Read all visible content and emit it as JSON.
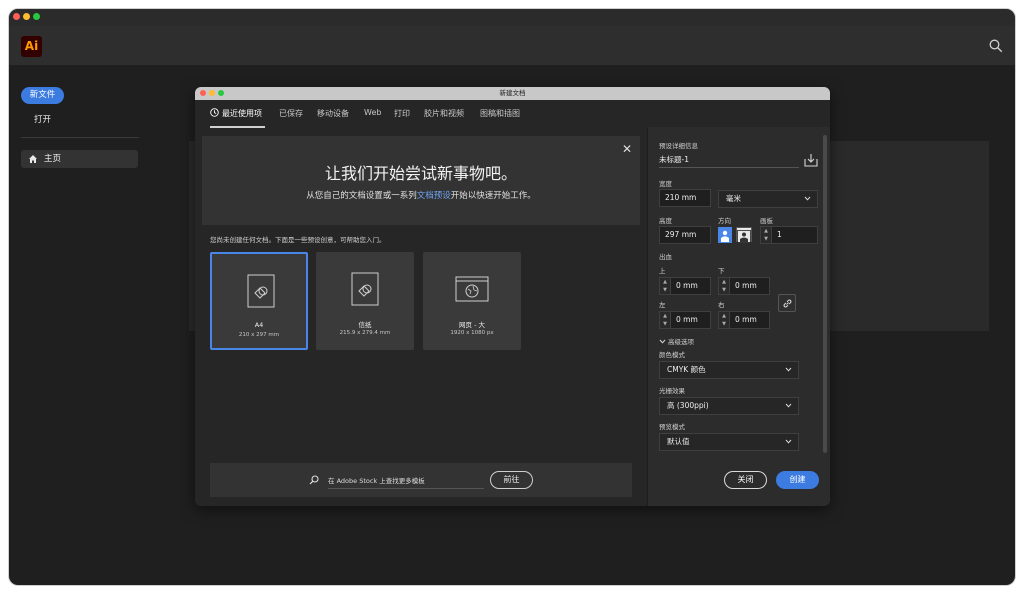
{
  "app": {
    "logo_text": "Ai"
  },
  "sidebar": {
    "new_file": "新文件",
    "open": "打开",
    "home": "主页"
  },
  "dialog": {
    "title": "新建文档",
    "tabs": [
      "最近使用项",
      "已保存",
      "移动设备",
      "Web",
      "打印",
      "胶片和视频",
      "图稿和插图"
    ],
    "hero_title": "让我们开始尝试新事物吧。",
    "hero_sub_prefix": "从您自己的文档设置或一系列",
    "hero_sub_link": "文档预设",
    "hero_sub_suffix": "开始以快速开始工作。",
    "info": "您尚未创建任何文档。下面是一些预设创意，可帮助您入门。",
    "presets": [
      {
        "name": "A4",
        "size": "210 x 297 mm"
      },
      {
        "name": "信纸",
        "size": "215.9 x 279.4 mm"
      },
      {
        "name": "网页 - 大",
        "size": "1920 x 1080 px"
      }
    ],
    "stock_text": "在 Adobe Stock 上查找更多模板",
    "stock_go": "前往"
  },
  "details": {
    "heading": "预设详细信息",
    "name": "未标题-1",
    "width_label": "宽度",
    "width_value": "210 mm",
    "unit": "毫米",
    "height_label": "高度",
    "height_value": "297 mm",
    "orientation_label": "方向",
    "artboards_label": "画板",
    "artboards_value": "1",
    "bleed_label": "出血",
    "top_label": "上",
    "bottom_label": "下",
    "left_label": "左",
    "right_label": "右",
    "top_value": "0 mm",
    "bottom_value": "0 mm",
    "left_value": "0 mm",
    "right_value": "0 mm",
    "advanced_label": "高级选项",
    "color_mode_label": "颜色模式",
    "color_mode_value": "CMYK 颜色",
    "raster_label": "光栅效果",
    "raster_value": "高 (300ppi)",
    "preview_label": "预览模式",
    "preview_value": "默认值",
    "close_btn": "关闭",
    "create_btn": "创建"
  },
  "colors": {
    "accent": "#3c7be0",
    "link": "#6fa4f5",
    "ai_logo_bg": "#330000",
    "ai_logo_fg": "#ff9a00"
  }
}
